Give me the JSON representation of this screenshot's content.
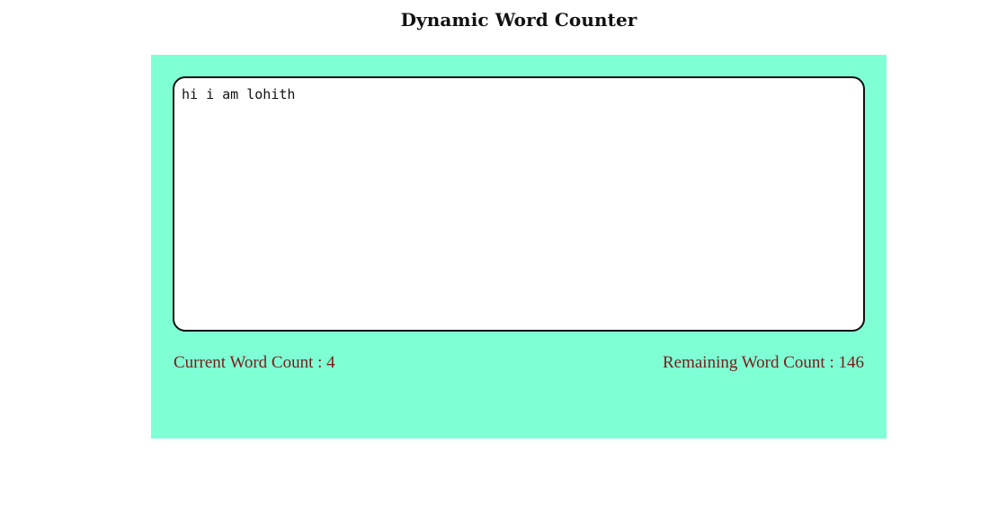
{
  "page": {
    "title": "Dynamic Word Counter"
  },
  "editor": {
    "value": "hi i am lohith"
  },
  "counts": {
    "current_label": "Current Word Count : 4",
    "remaining_label": "Remaining Word Count : 146"
  },
  "colors": {
    "panel_background": "#7fffd4",
    "count_text": "#7a1b1b",
    "border": "#111111"
  }
}
